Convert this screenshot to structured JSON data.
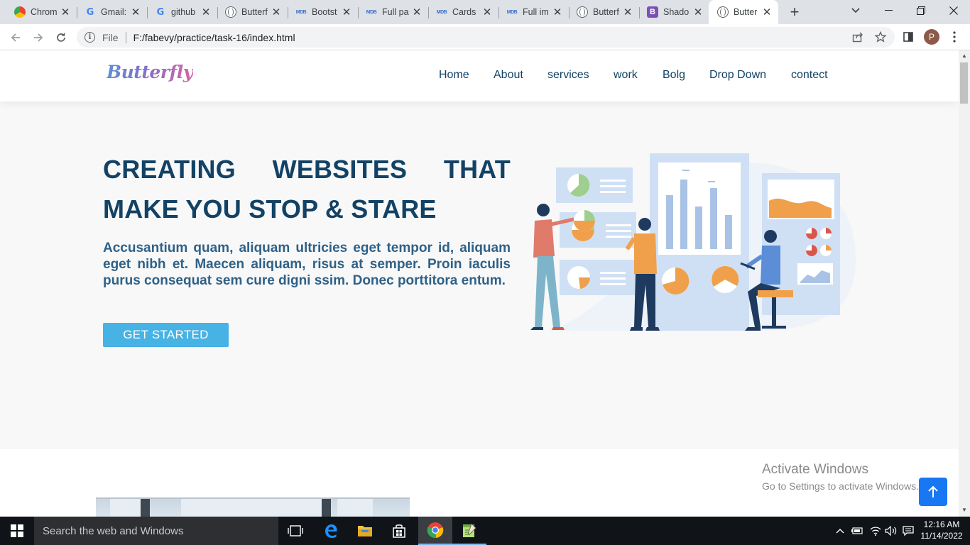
{
  "browser": {
    "tabs": [
      {
        "title": "Chrom",
        "icon": "chrome-icon"
      },
      {
        "title": "Gmail:",
        "icon": "google-icon"
      },
      {
        "title": "github",
        "icon": "google-icon"
      },
      {
        "title": "Butterf",
        "icon": "globe-icon"
      },
      {
        "title": "Bootst",
        "icon": "mdb-icon"
      },
      {
        "title": "Full pa",
        "icon": "mdb-icon"
      },
      {
        "title": "Cards",
        "icon": "mdb-icon"
      },
      {
        "title": "Full im",
        "icon": "mdb-icon"
      },
      {
        "title": "Butterf",
        "icon": "globe-icon"
      },
      {
        "title": "Shado",
        "icon": "bootstrap-icon"
      },
      {
        "title": "Butter",
        "icon": "globe-icon",
        "active": true
      }
    ],
    "address": {
      "scheme_label": "File",
      "url": "F:/fabevy/practice/task-16/index.html"
    },
    "profile_initial": "P"
  },
  "site": {
    "logo": "Butterfly",
    "nav": [
      "Home",
      "About",
      "services",
      "work",
      "Bolg",
      "Drop Down",
      "contect"
    ],
    "hero": {
      "title_line1_words": [
        "CREATING",
        "WEBSITES",
        "THAT"
      ],
      "title_line2": "MAKE YOU STOP & STARE",
      "subtitle": "Accusantium quam, aliquam ultricies eget tempor id, aliquam eget nibh et. Maecen aliquam, risus at semper. Proin iaculis purus consequat sem cure digni ssim. Donec porttitora entum.",
      "cta": "GET STARTED"
    }
  },
  "watermark": {
    "line1": "Activate Windows",
    "line2": "Go to Settings to activate Windows."
  },
  "taskbar": {
    "search_placeholder": "Search the web and Windows",
    "time": "12:16 AM",
    "date": "11/14/2022"
  },
  "colors": {
    "brand_dark": "#124265",
    "accent": "#47b2e4",
    "to_top": "#1877f2"
  }
}
